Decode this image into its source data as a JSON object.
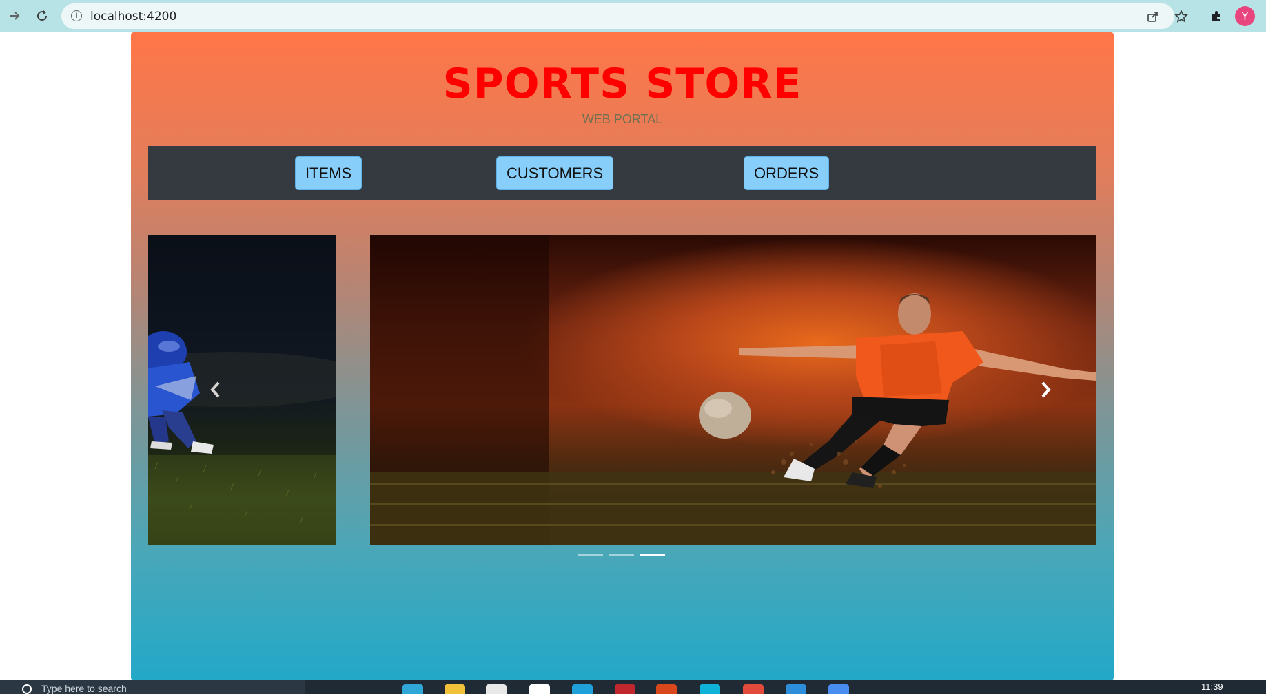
{
  "browser": {
    "url": "localhost:4200",
    "avatar_letter": "Y",
    "icons": [
      "forward-icon",
      "reload-icon",
      "info-icon",
      "share-icon",
      "star-icon",
      "extensions-icon"
    ]
  },
  "header": {
    "title": "SPORTS STORE",
    "subtitle": "WEB PORTAL"
  },
  "nav": {
    "items": [
      {
        "label": "ITEMS"
      },
      {
        "label": "CUSTOMERS"
      },
      {
        "label": "ORDERS"
      }
    ]
  },
  "carousel": {
    "slide_count": 3,
    "active_index": 2,
    "prev_slide": "american-football-player-image",
    "active_slide": "soccer-player-kicking-ball-image"
  },
  "taskbar": {
    "search_hint": "Type here to search",
    "clock": "11:39"
  },
  "colors": {
    "title": "#ff0000",
    "nav_bar": "#343a40",
    "nav_button": "#87cefa",
    "gradient_top": "#ff7648",
    "gradient_bottom": "#22a8c8"
  }
}
